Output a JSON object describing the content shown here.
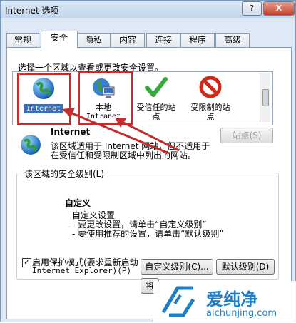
{
  "window": {
    "title": "Internet 选项"
  },
  "titlebar": {
    "help_label": "?",
    "close_label": "X"
  },
  "tabs": [
    {
      "label": "常规"
    },
    {
      "label": "安全"
    },
    {
      "label": "隐私"
    },
    {
      "label": "内容"
    },
    {
      "label": "连接"
    },
    {
      "label": "程序"
    },
    {
      "label": "高级"
    }
  ],
  "security": {
    "prompt": "选择一个区域以查看或更改安全设置。",
    "zones": [
      {
        "label": "Internet",
        "icon": "globe-icon"
      },
      {
        "label": "本地",
        "sub": "Intranet",
        "icon": "intranet-icon"
      },
      {
        "label": "受信任的站",
        "sub": "点",
        "icon": "checkmark-icon"
      },
      {
        "label": "受限制的站",
        "sub": "点",
        "icon": "restricted-icon"
      }
    ],
    "zone_title": "Internet",
    "zone_desc_1": "该区域适用于 Internet 网站，但不适用于",
    "zone_desc_2": "在受信任和受限制区域中列出的网站。",
    "sites_button": "站点(S)",
    "level_group_label": "该区域的安全级别(L)",
    "custom_title": "自定义",
    "custom_line1": "自定义设置",
    "custom_line2": "- 要更改设置，请单击“自定义级别”",
    "custom_line3": "- 要使用推荐的设置，请单击“默认级别”",
    "protected_mode_label_1": "启用保护模式(要求重新启动",
    "protected_mode_label_2": "Internet Explorer)(P)",
    "protected_mode_checked": true,
    "custom_level_button": "自定义级别(C)...",
    "default_level_button": "默认级别(D)",
    "bottom_partial": "将"
  },
  "watermark": {
    "brand": "爱纯净",
    "url": "aichunjing.com"
  },
  "colors": {
    "annotation_red": "#c22d2d",
    "selected_blue": "#3a6fb4"
  }
}
